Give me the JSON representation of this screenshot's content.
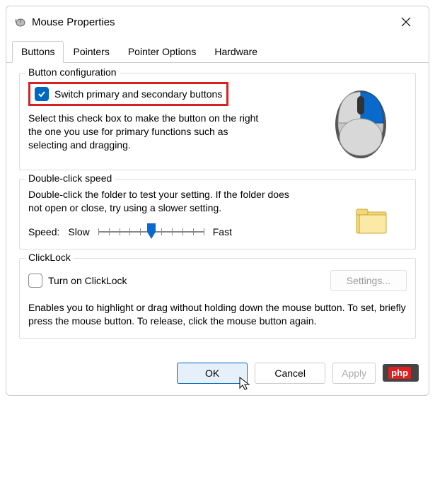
{
  "window": {
    "title": "Mouse Properties"
  },
  "tabs": [
    "Buttons",
    "Pointers",
    "Pointer Options",
    "Hardware"
  ],
  "buttonConfig": {
    "title": "Button configuration",
    "switchLabel": "Switch primary and secondary buttons",
    "switchChecked": true,
    "desc": "Select this check box to make the button on the right the one you use for primary functions such as selecting and dragging."
  },
  "doubleClick": {
    "title": "Double-click speed",
    "desc": "Double-click the folder to test your setting. If the folder does not open or close, try using a slower setting.",
    "speedLabel": "Speed:",
    "slow": "Slow",
    "fast": "Fast"
  },
  "clickLock": {
    "title": "ClickLock",
    "turnOn": "Turn on ClickLock",
    "settings": "Settings...",
    "desc": "Enables you to highlight or drag without holding down the mouse button. To set, briefly press the mouse button. To release, click the mouse button again."
  },
  "footer": {
    "ok": "OK",
    "cancel": "Cancel",
    "apply": "Apply"
  },
  "badge": {
    "left": "php",
    "right": ""
  }
}
